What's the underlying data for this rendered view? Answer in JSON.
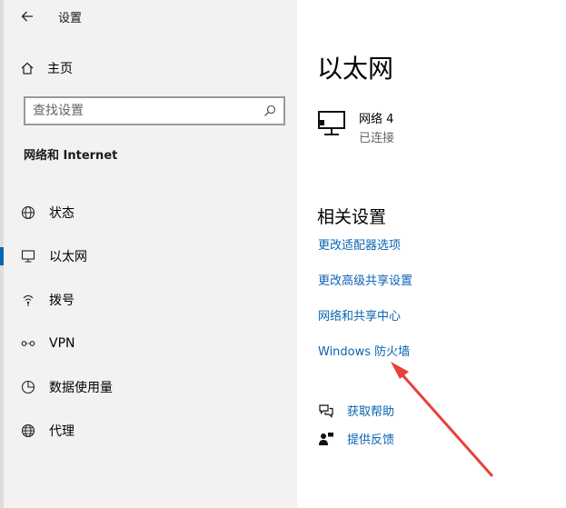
{
  "window": {
    "title": "设置"
  },
  "sidebar": {
    "home_label": "主页",
    "search_placeholder": "查找设置",
    "section_title": "网络和 Internet",
    "items": [
      {
        "label": "状态",
        "icon": "globe-status-icon"
      },
      {
        "label": "以太网",
        "icon": "ethernet-monitor-icon",
        "active": true
      },
      {
        "label": "拨号",
        "icon": "dialup-icon"
      },
      {
        "label": "VPN",
        "icon": "vpn-icon"
      },
      {
        "label": "数据使用量",
        "icon": "data-usage-icon"
      },
      {
        "label": "代理",
        "icon": "globe-icon"
      }
    ]
  },
  "main": {
    "title": "以太网",
    "connection": {
      "name": "网络 4",
      "status": "已连接"
    },
    "related_title": "相关设置",
    "links": [
      "更改适配器选项",
      "更改高级共享设置",
      "网络和共享中心",
      "Windows 防火墙"
    ],
    "help": [
      {
        "label": "获取帮助",
        "icon": "help-chat-icon"
      },
      {
        "label": "提供反馈",
        "icon": "feedback-icon"
      }
    ]
  },
  "colors": {
    "accent": "#0a64b4",
    "sidebar_bg": "#f2f2f2",
    "annotation_arrow": "#e8403b"
  }
}
